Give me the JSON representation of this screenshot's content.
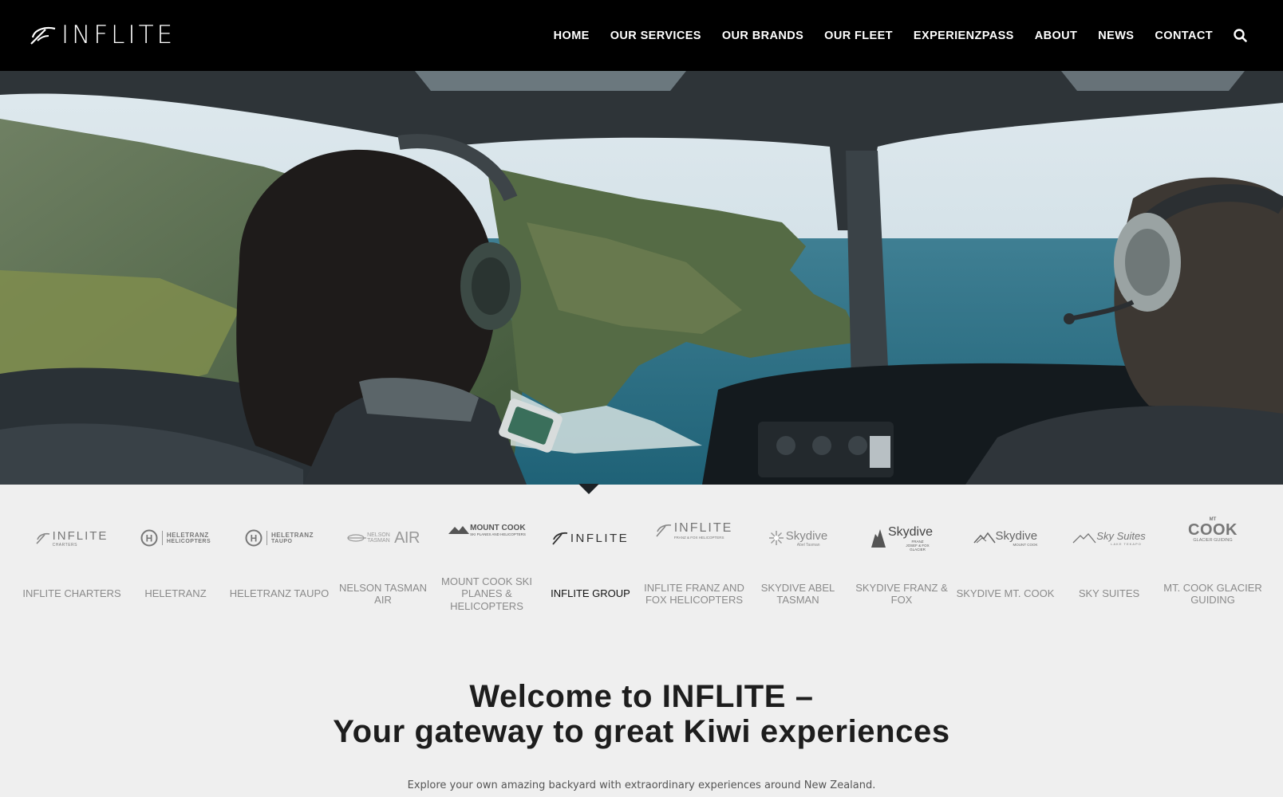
{
  "header": {
    "logo_text": "INFLITE",
    "nav": [
      {
        "label": "HOME"
      },
      {
        "label": "OUR SERVICES"
      },
      {
        "label": "OUR BRANDS"
      },
      {
        "label": "OUR FLEET"
      },
      {
        "label": "EXPERIENZPASS"
      },
      {
        "label": "ABOUT"
      },
      {
        "label": "NEWS"
      },
      {
        "label": "CONTACT"
      }
    ],
    "search_icon": "search-icon"
  },
  "hero": {
    "image": "helicopter-cockpit-coastline-photo"
  },
  "brands": [
    {
      "label": "INFLITE CHARTERS",
      "logo_text": "INFLITE",
      "logo_sub": "CHARTERS",
      "active": false
    },
    {
      "label": "HELETRANZ",
      "logo_text": "HELETRANZ",
      "logo_sub": "HELICOPTERS",
      "active": false
    },
    {
      "label": "HELETRANZ TAUPO",
      "logo_text": "HELETRANZ",
      "logo_sub": "TAUPO",
      "active": false
    },
    {
      "label": "NELSON TASMAN AIR",
      "logo_text": "AIR",
      "logo_sub": "NELSON TASMAN",
      "active": false
    },
    {
      "label": "MOUNT COOK SKI PLANES & HELICOPTERS",
      "logo_text": "MOUNT COOK",
      "logo_sub": "SKI PLANES AND HELICOPTERS",
      "active": false
    },
    {
      "label": "INFLITE GROUP",
      "logo_text": "INFLITE",
      "logo_sub": "",
      "active": true
    },
    {
      "label": "INFLITE FRANZ AND FOX HELICOPTERS",
      "logo_text": "INFLITE",
      "logo_sub": "FRANZ & FOX HELICOPTERS",
      "active": false
    },
    {
      "label": "SKYDIVE ABEL TASMAN",
      "logo_text": "Skydive",
      "logo_sub": "Abel Tasman",
      "active": false
    },
    {
      "label": "SKYDIVE FRANZ & FOX",
      "logo_text": "Skydive",
      "logo_sub": "FRANZ JOSEF & FOX GLACIER",
      "active": false
    },
    {
      "label": "SKYDIVE MT. COOK",
      "logo_text": "Skydive",
      "logo_sub": "MOUNT COOK",
      "active": false
    },
    {
      "label": "SKY SUITES",
      "logo_text": "Sky Suites",
      "logo_sub": "LAKE TEKAPO",
      "active": false
    },
    {
      "label": "MT. COOK GLACIER GUIDING",
      "logo_text": "COOK",
      "logo_sub": "GLACIER GUIDING",
      "logo_top": "MT",
      "active": false
    }
  ],
  "welcome": {
    "title_line1": "Welcome to INFLITE –",
    "title_line2": "Your gateway to great Kiwi experiences",
    "subtitle": "Explore your own amazing backyard with extraordinary experiences around New Zealand."
  },
  "colors": {
    "header_bg": "#000000",
    "page_bg": "#efefef",
    "brand_label": "#8a8a8a",
    "brand_label_active": "#111111"
  }
}
